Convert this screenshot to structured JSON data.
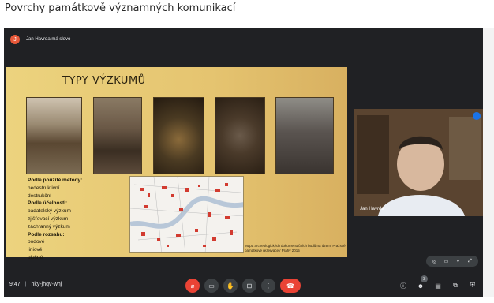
{
  "page_title": "Povrchy památkově významných komunikací",
  "speaker": {
    "avatar_letter": "J",
    "text": "Jan Havrda má slovo"
  },
  "slide": {
    "title": "TYPY VÝZKUMŮ",
    "legend": [
      {
        "text": "Podle použité metody:",
        "heading": true
      },
      {
        "text": "nedestruktivní",
        "heading": false
      },
      {
        "text": "destrukční",
        "heading": false
      },
      {
        "text": "Podle účelnosti:",
        "heading": true
      },
      {
        "text": "badatelský výzkum",
        "heading": false
      },
      {
        "text": "zjišťovací výzkum",
        "heading": false
      },
      {
        "text": "záchranný výzkum",
        "heading": false
      },
      {
        "text": "Podle rozsahu:",
        "heading": true
      },
      {
        "text": "bodové",
        "heading": false
      },
      {
        "text": "liniové",
        "heading": false
      },
      {
        "text": "plošné",
        "heading": false
      }
    ],
    "map_note": "Mapa archeologických dokumentačních bodů na území Pražské památkové rezervace / Prahy 2015"
  },
  "camera": {
    "name": "Jan Havrda"
  },
  "meeting": {
    "time": "9:47",
    "code": "hky-jhqv-whj"
  },
  "participants_count": "3",
  "colors": {
    "accent": "#1a73e8",
    "danger": "#ea4335"
  },
  "icons": {
    "mic": "mic-off-icon",
    "camera": "videocam-icon",
    "hand": "hand-icon",
    "present": "present-icon",
    "more": "more-vert-icon",
    "hangup": "call-end-icon",
    "info": "info-icon",
    "people": "people-icon",
    "chat": "chat-icon",
    "activities": "activities-icon",
    "lock": "host-controls-icon"
  }
}
